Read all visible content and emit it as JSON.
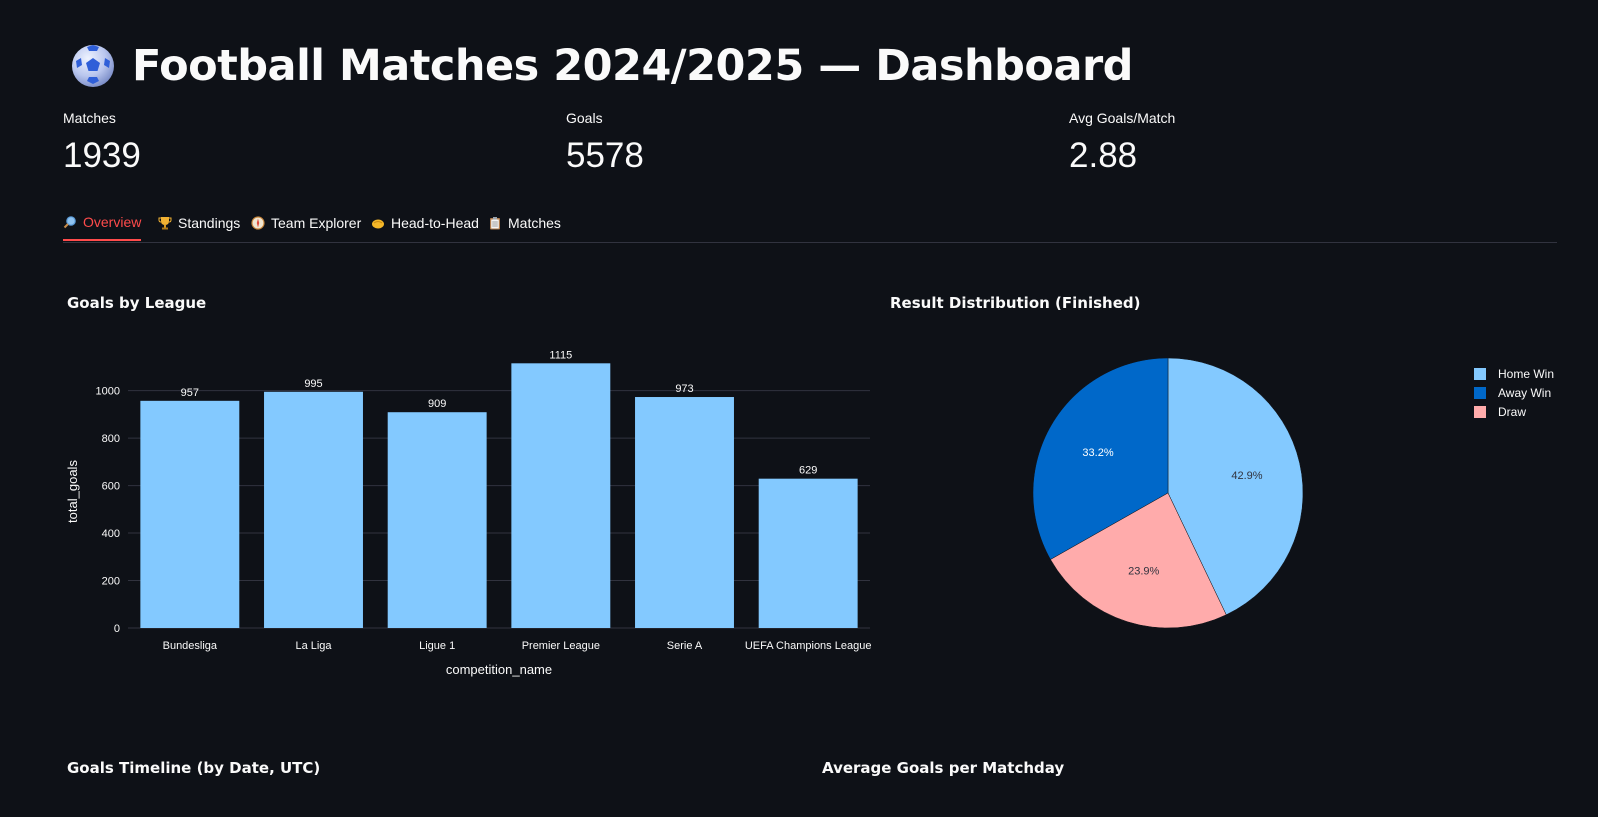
{
  "page": {
    "title": "Football Matches 2024/2025 — Dashboard",
    "title_icon": "soccer-ball-icon"
  },
  "metrics": [
    {
      "label": "Matches",
      "value": "1939"
    },
    {
      "label": "Goals",
      "value": "5578"
    },
    {
      "label": "Avg Goals/Match",
      "value": "2.88"
    }
  ],
  "tabs": [
    {
      "label": "Overview",
      "icon": "magnifier-icon",
      "active": true
    },
    {
      "label": "Standings",
      "icon": "trophy-icon",
      "active": false
    },
    {
      "label": "Team Explorer",
      "icon": "compass-icon",
      "active": false
    },
    {
      "label": "Head-to-Head",
      "icon": "handshake-icon",
      "active": false
    },
    {
      "label": "Matches",
      "icon": "clipboard-icon",
      "active": false
    }
  ],
  "sections": {
    "goals_by_league": "Goals by League",
    "result_distribution": "Result Distribution (Finished)",
    "goals_timeline": "Goals Timeline (by Date, UTC)",
    "avg_goals_matchday": "Average Goals per Matchday"
  },
  "colors": {
    "background": "#0e1117",
    "accent": "#ff4b4b",
    "bar": "#83c9ff",
    "home_win": "#83c9ff",
    "away_win": "#0068c9",
    "draw": "#ffabab",
    "grid": "#31333f"
  },
  "chart_data": [
    {
      "type": "bar",
      "title": "Goals by League",
      "categories": [
        "Bundesliga",
        "La Liga",
        "Ligue 1",
        "Premier League",
        "Serie A",
        "UEFA Champions League"
      ],
      "values": [
        957,
        995,
        909,
        1115,
        973,
        629
      ],
      "data_labels": [
        "957",
        "995",
        "909",
        "1115",
        "973",
        "629"
      ],
      "xlabel": "competition_name",
      "ylabel": "total_goals",
      "ylim": [
        0,
        1150
      ],
      "yticks": [
        0,
        200,
        400,
        600,
        800,
        1000
      ],
      "ytick_labels": [
        "0",
        "200",
        "400",
        "600",
        "800",
        "1000"
      ],
      "grid": true
    },
    {
      "type": "pie",
      "title": "Result Distribution (Finished)",
      "slices": [
        {
          "name": "Home Win",
          "value": 42.9,
          "label": "42.9%"
        },
        {
          "name": "Away Win",
          "value": 33.2,
          "label": "33.2%"
        },
        {
          "name": "Draw",
          "value": 23.9,
          "label": "23.9%"
        }
      ],
      "legend_placement": "top-right"
    }
  ]
}
